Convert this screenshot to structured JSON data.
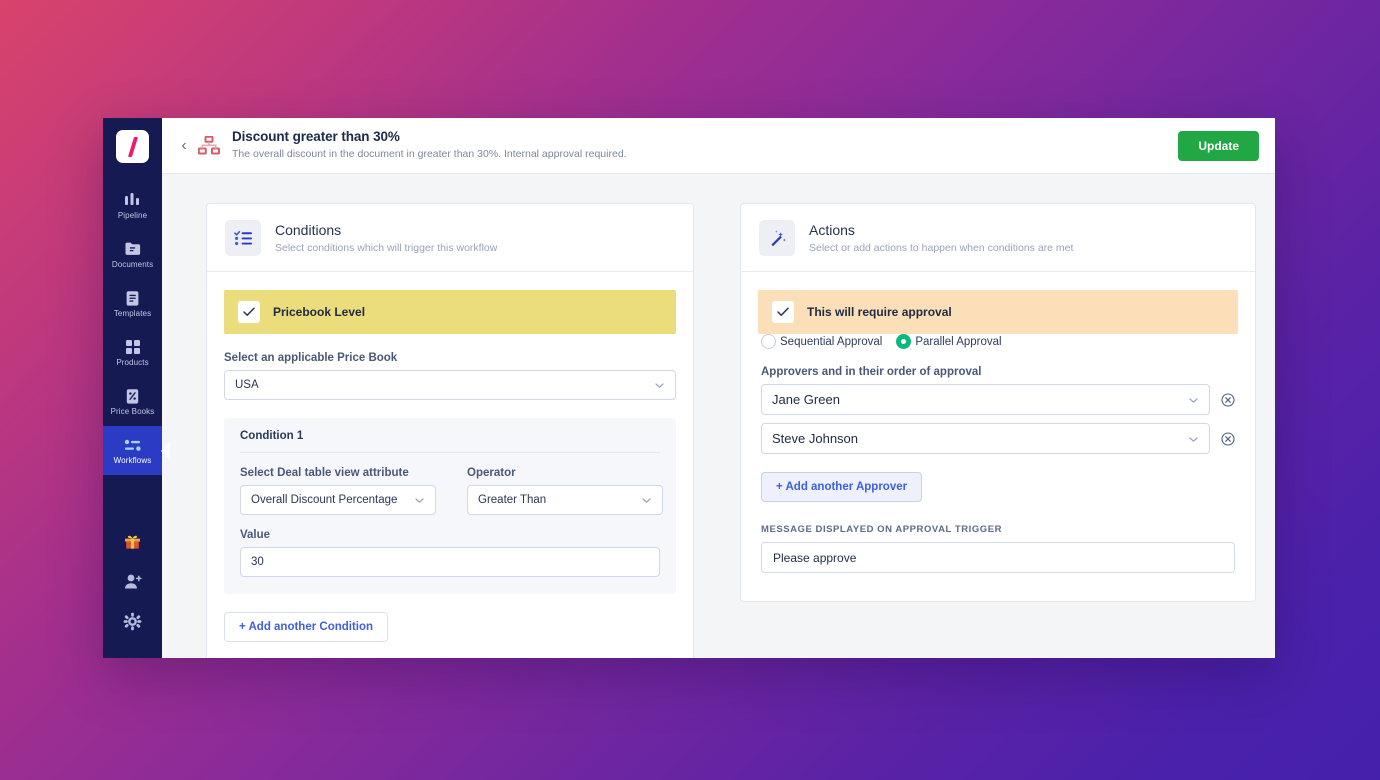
{
  "theme": {
    "accent_green": "#22a745",
    "accent_blue": "#2b3bc4",
    "sidebar_bg": "#161a52",
    "banner_yellow": "#ebdd7c",
    "banner_orange": "#fbdfb8",
    "radio_on": "#0bb87a",
    "logo_pink": "#ee1a6e"
  },
  "sidebar": {
    "logo_icon": "slash-logo-icon",
    "items": [
      {
        "label": "Pipeline",
        "icon": "pipeline-icon",
        "active": false
      },
      {
        "label": "Documents",
        "icon": "documents-icon",
        "active": false
      },
      {
        "label": "Templates",
        "icon": "templates-icon",
        "active": false
      },
      {
        "label": "Products",
        "icon": "products-icon",
        "active": false
      },
      {
        "label": "Price Books",
        "icon": "price-books-icon",
        "active": false
      },
      {
        "label": "Workflows",
        "icon": "workflows-icon",
        "active": true
      }
    ],
    "bottom_items": [
      {
        "icon": "gift-icon"
      },
      {
        "icon": "add-user-icon"
      },
      {
        "icon": "settings-gear-icon"
      }
    ]
  },
  "header": {
    "back_icon": "chevron-left-icon",
    "workflow_icon": "org-chart-icon",
    "title": "Discount greater than 30%",
    "subtitle": "The overall discount in the document in greater than 30%. Internal approval required.",
    "update_label": "Update"
  },
  "conditions": {
    "icon": "checklist-icon",
    "title": "Conditions",
    "subtitle": "Select conditions which will trigger this workflow",
    "banner": {
      "label": "Pricebook Level",
      "checked": true,
      "check_icon": "check-icon"
    },
    "price_book": {
      "label": "Select an applicable Price Book",
      "value": "USA",
      "chevron_icon": "chevron-down-icon"
    },
    "condition": {
      "title": "Condition 1",
      "attribute_label": "Select Deal table view attribute",
      "attribute_value": "Overall Discount Percentage",
      "operator_label": "Operator",
      "operator_value": "Greater Than",
      "value_label": "Value",
      "value_value": "30"
    },
    "add_condition_label": "+ Add another Condition"
  },
  "actions": {
    "icon": "magic-wand-icon",
    "title": "Actions",
    "subtitle": "Select or add actions to happen when conditions are met",
    "banner": {
      "label": "This will require approval",
      "checked": true,
      "check_icon": "check-icon"
    },
    "approval_modes": [
      {
        "label": "Sequential Approval",
        "selected": false
      },
      {
        "label": "Parallel Approval",
        "selected": true
      }
    ],
    "approvers_label": "Approvers and in their order of approval",
    "approvers": [
      {
        "name": "Jane Green",
        "remove_icon": "remove-circle-icon",
        "chevron_icon": "chevron-down-icon"
      },
      {
        "name": "Steve Johnson",
        "remove_icon": "remove-circle-icon",
        "chevron_icon": "chevron-down-icon"
      }
    ],
    "add_approver_label": "+ Add another Approver",
    "message_label": "MESSAGE DISPLAYED ON APPROVAL TRIGGER",
    "message_value": "Please approve"
  }
}
